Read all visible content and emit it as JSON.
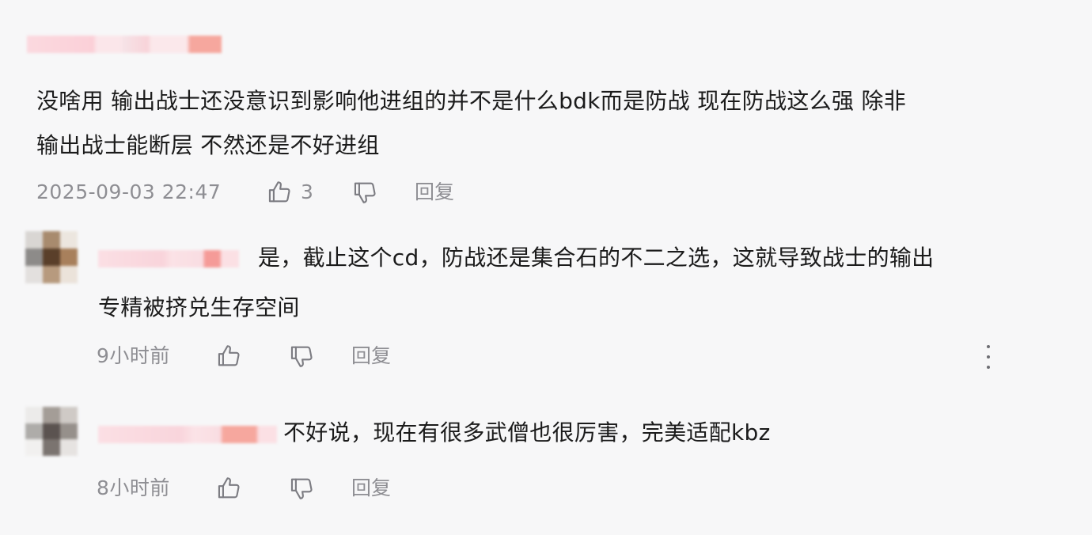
{
  "main_comment": {
    "text_line1": "没啥用 输出战士还没意识到影响他进组的并不是什么bdk而是防战 现在防战这么强 除非",
    "text_line2": "输出战士能断层 不然还是不好进组",
    "timestamp": "2025-09-03 22:47",
    "like_count": "3",
    "reply_label": "回复"
  },
  "replies": [
    {
      "text_line1": "是，截止这个cd，防战还是集合石的不二之选，这就导致战士的输出",
      "text_line2": "专精被挤兑生存空间",
      "time": "9小时前",
      "reply_label": "回复"
    },
    {
      "text_line1": "不好说，现在有很多武僧也很厉害，完美适配kbz",
      "time": "8小时前",
      "reply_label": "回复"
    }
  ],
  "icons": {
    "like": "thumbs-up-icon",
    "dislike": "thumbs-down-icon",
    "more": "more-vertical-icon"
  },
  "colors": {
    "background": "#f7f7f8",
    "text": "#1b1b1b",
    "meta": "#8e8e93"
  }
}
